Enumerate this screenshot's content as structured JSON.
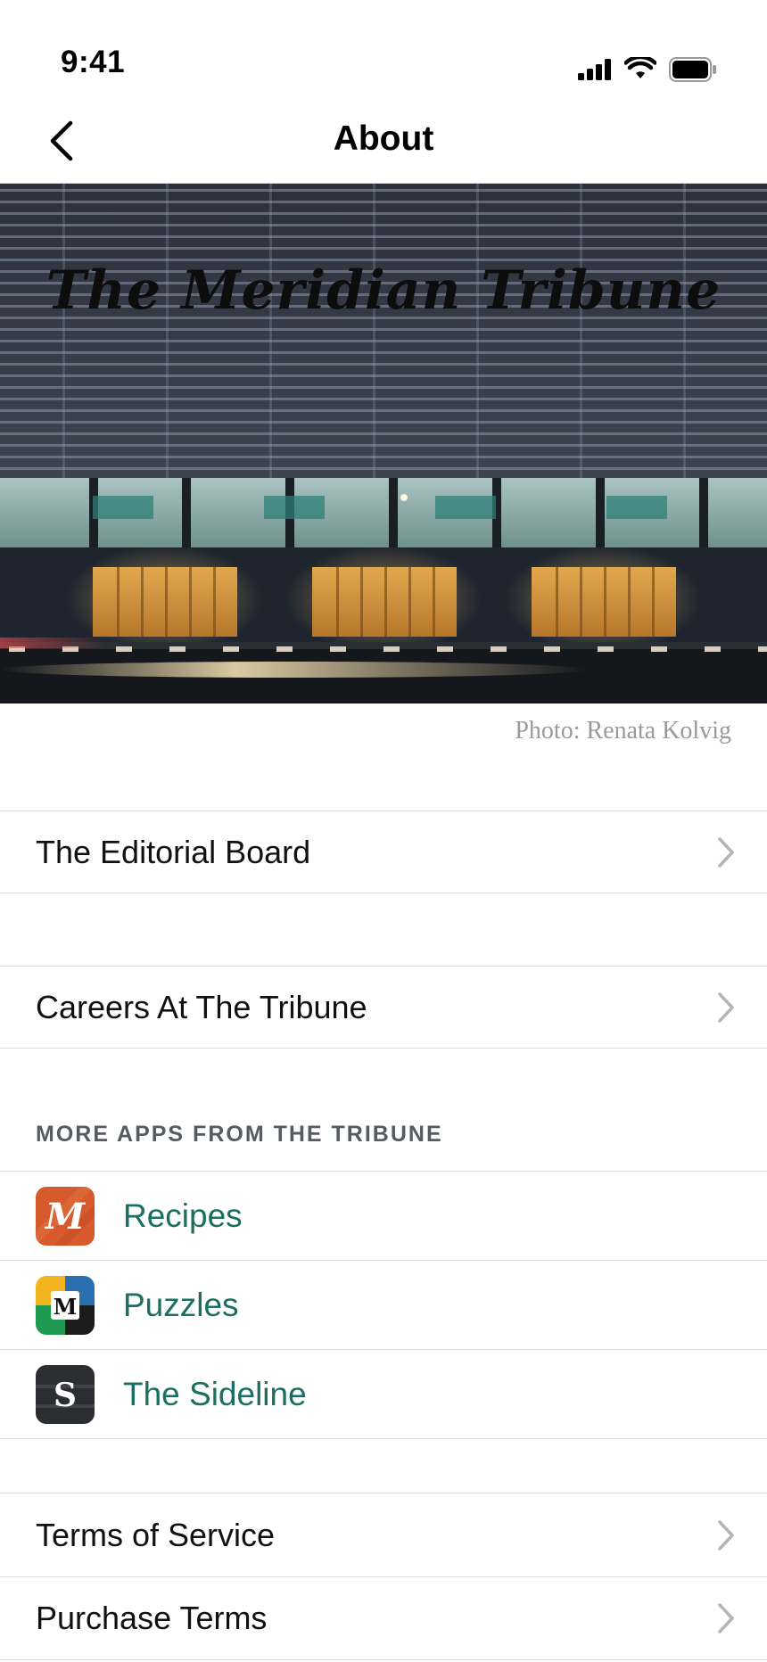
{
  "status_bar": {
    "time": "9:41"
  },
  "nav": {
    "title": "About"
  },
  "hero": {
    "logo_text": "The Meridian Tribune",
    "photo_credit": "Photo: Renata Kolvig"
  },
  "links_primary": [
    {
      "label": "The Editorial Board"
    },
    {
      "label": "Careers At The Tribune"
    }
  ],
  "more_apps": {
    "header": "MORE APPS FROM THE TRIBUNE",
    "apps": [
      {
        "label": "Recipes",
        "icon_letter": "M",
        "icon": "recipes-app-icon"
      },
      {
        "label": "Puzzles",
        "icon_letter": "M",
        "icon": "puzzles-app-icon"
      },
      {
        "label": "The Sideline",
        "icon_letter": "S",
        "icon": "sideline-app-icon"
      }
    ]
  },
  "links_legal": [
    {
      "label": "Terms of Service"
    },
    {
      "label": "Purchase Terms"
    }
  ],
  "colors": {
    "app_link": "#1b6f62",
    "section_header": "#555b61",
    "divider": "#dcdcdc",
    "photo_credit": "#9a9a9a"
  }
}
